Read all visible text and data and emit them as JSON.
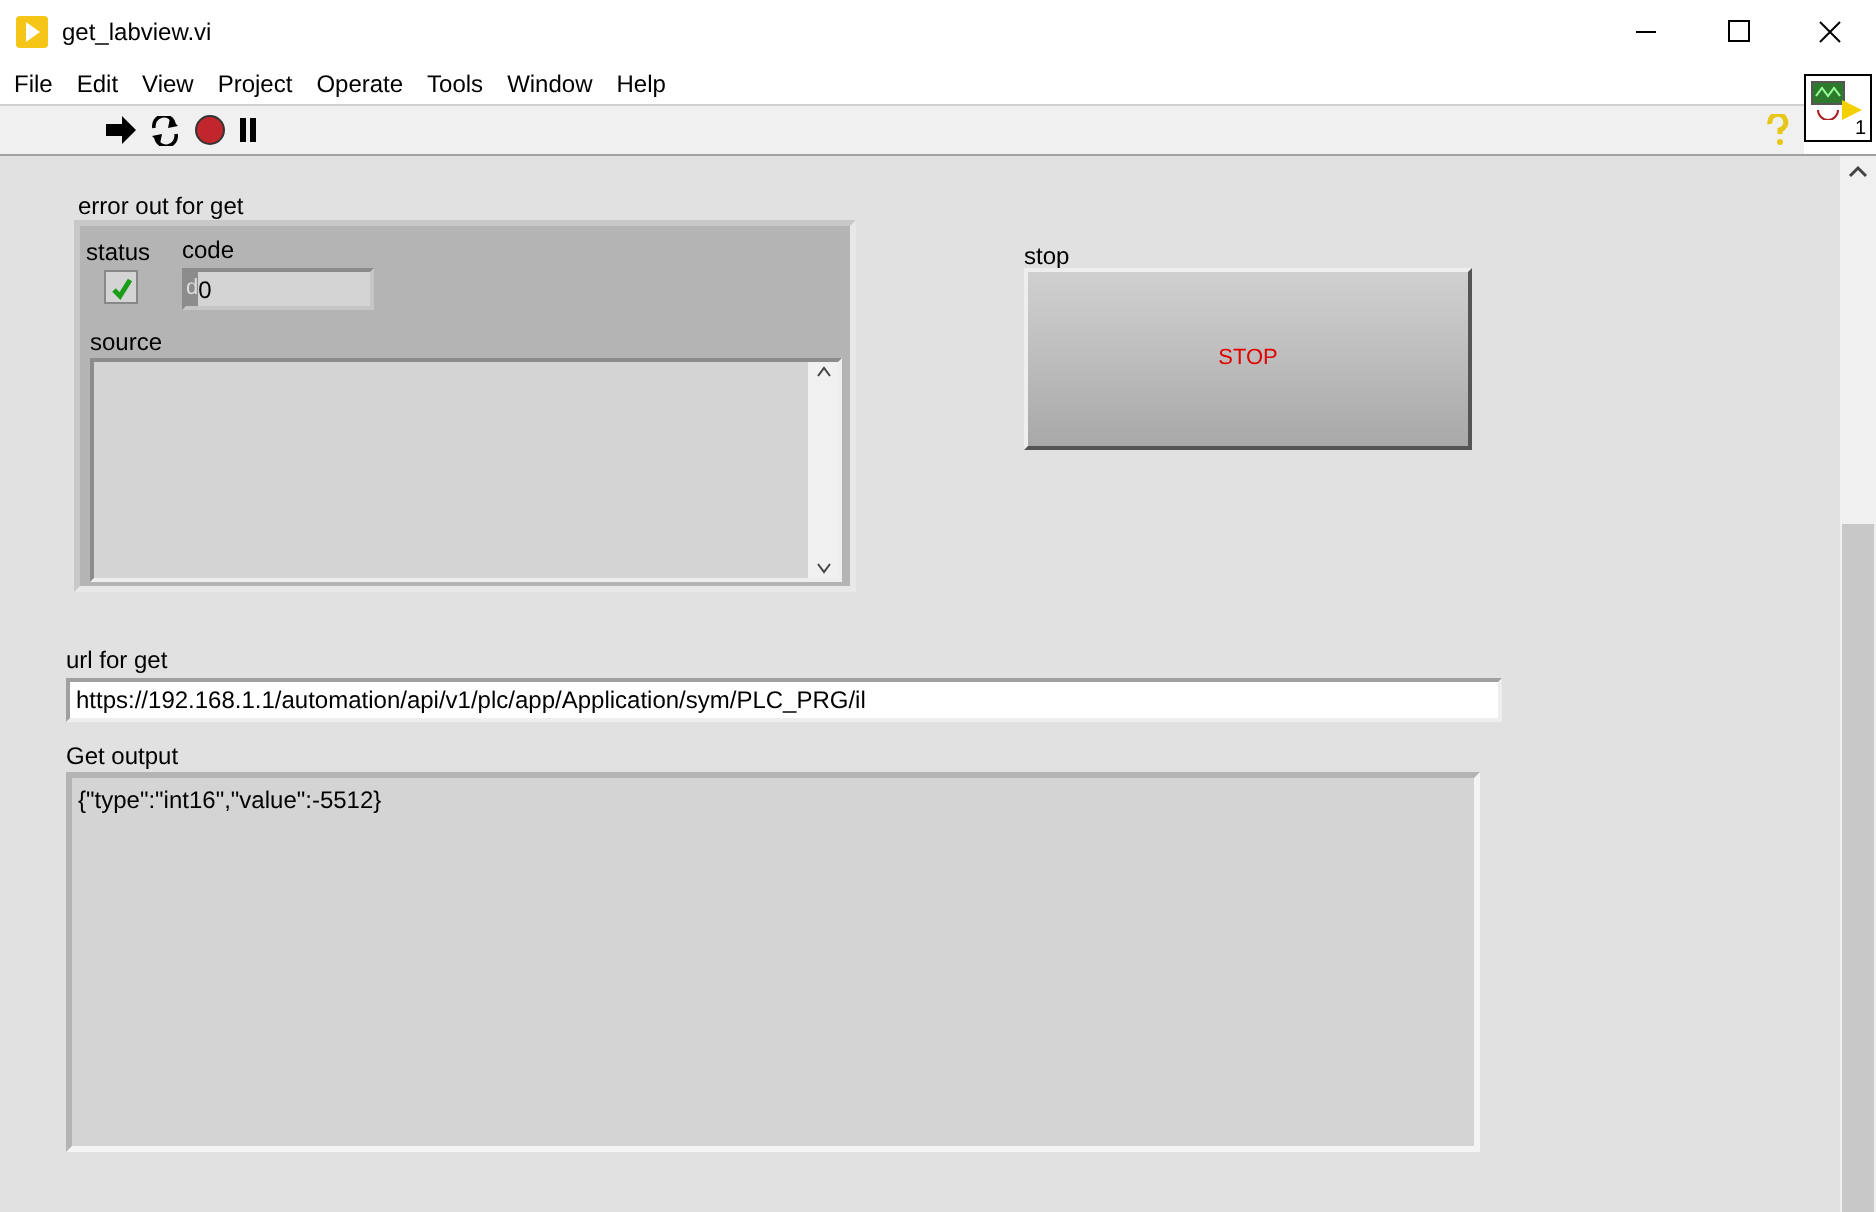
{
  "window": {
    "title": "get_labview.vi"
  },
  "menu": [
    {
      "label": "File"
    },
    {
      "label": "Edit"
    },
    {
      "label": "View"
    },
    {
      "label": "Project"
    },
    {
      "label": "Operate"
    },
    {
      "label": "Tools"
    },
    {
      "label": "Window"
    },
    {
      "label": "Help"
    }
  ],
  "vi_icon": {
    "label": "1"
  },
  "error_cluster": {
    "label": "error out for get",
    "status_label": "status",
    "status": {
      "checked": true
    },
    "code_label": "code",
    "radix": "d",
    "code": "0",
    "source_label": "source"
  },
  "stop": {
    "label": "stop",
    "button": "STOP"
  },
  "url": {
    "label": "url for get",
    "value": "https://192.168.1.1/automation/api/v1/plc/app/Application/sym/PLC_PRG/il"
  },
  "output": {
    "label": "Get output",
    "value": "{\"type\":\"int16\",\"value\":-5512}"
  }
}
